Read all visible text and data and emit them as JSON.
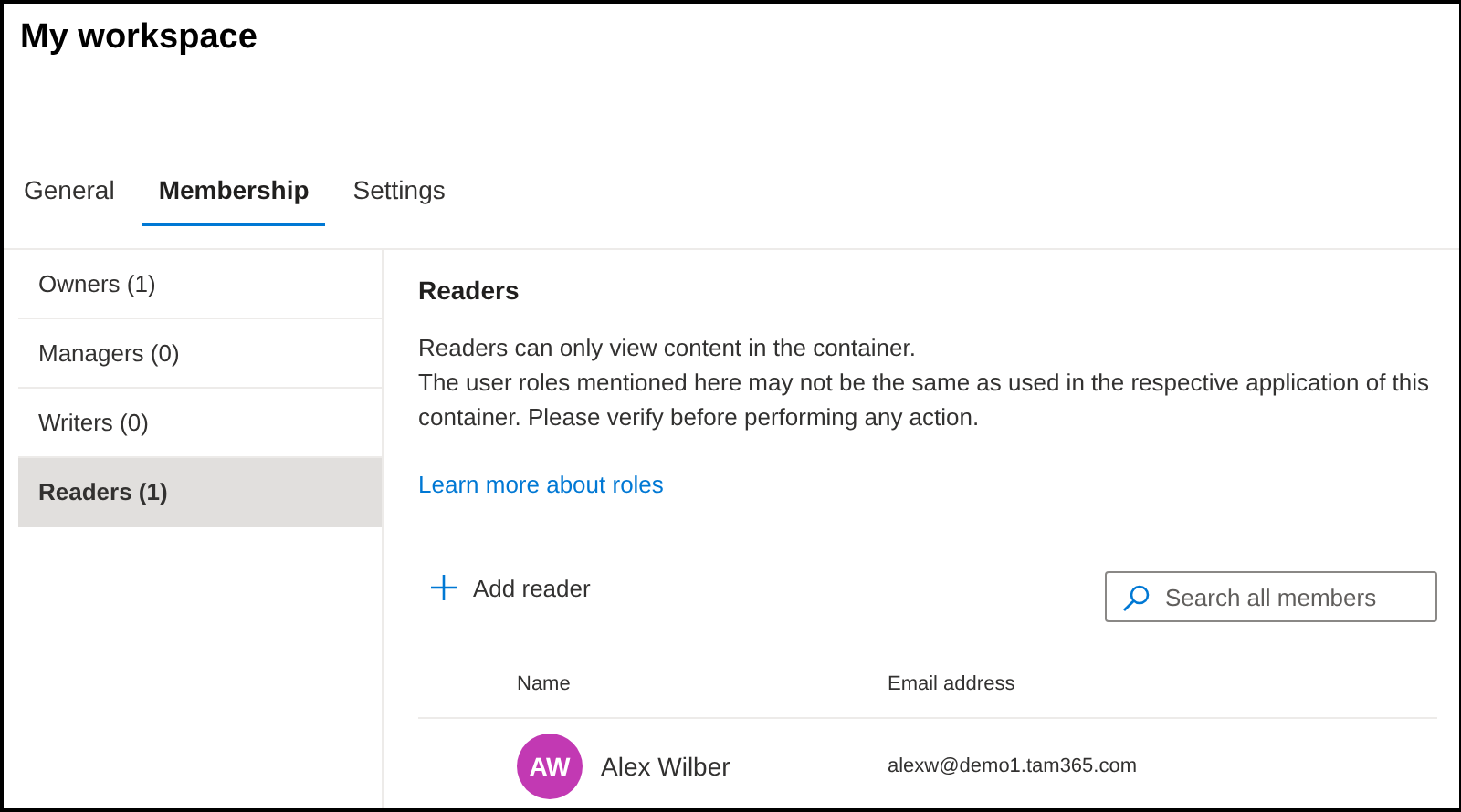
{
  "title": "My workspace",
  "tabs": [
    {
      "label": "General",
      "selected": false
    },
    {
      "label": "Membership",
      "selected": true
    },
    {
      "label": "Settings",
      "selected": false
    }
  ],
  "sidebar": {
    "items": [
      {
        "label": "Owners (1)",
        "selected": false
      },
      {
        "label": "Managers (0)",
        "selected": false
      },
      {
        "label": "Writers (0)",
        "selected": false
      },
      {
        "label": "Readers (1)",
        "selected": true
      }
    ]
  },
  "panel": {
    "heading": "Readers",
    "description": [
      "Readers can only view content in the container.",
      "The user roles mentioned here may not be the same as used in the respective application of this container. Please verify before performing any action."
    ],
    "link": "Learn more about roles",
    "add_button": "Add reader",
    "search": {
      "placeholder": "Search all members"
    },
    "table": {
      "columns": [
        "Name",
        "Email address"
      ],
      "rows": [
        {
          "initials": "AW",
          "color": "#c239b3",
          "name": "Alex Wilber",
          "email": "alexw@demo1.tam365.com"
        }
      ]
    }
  }
}
